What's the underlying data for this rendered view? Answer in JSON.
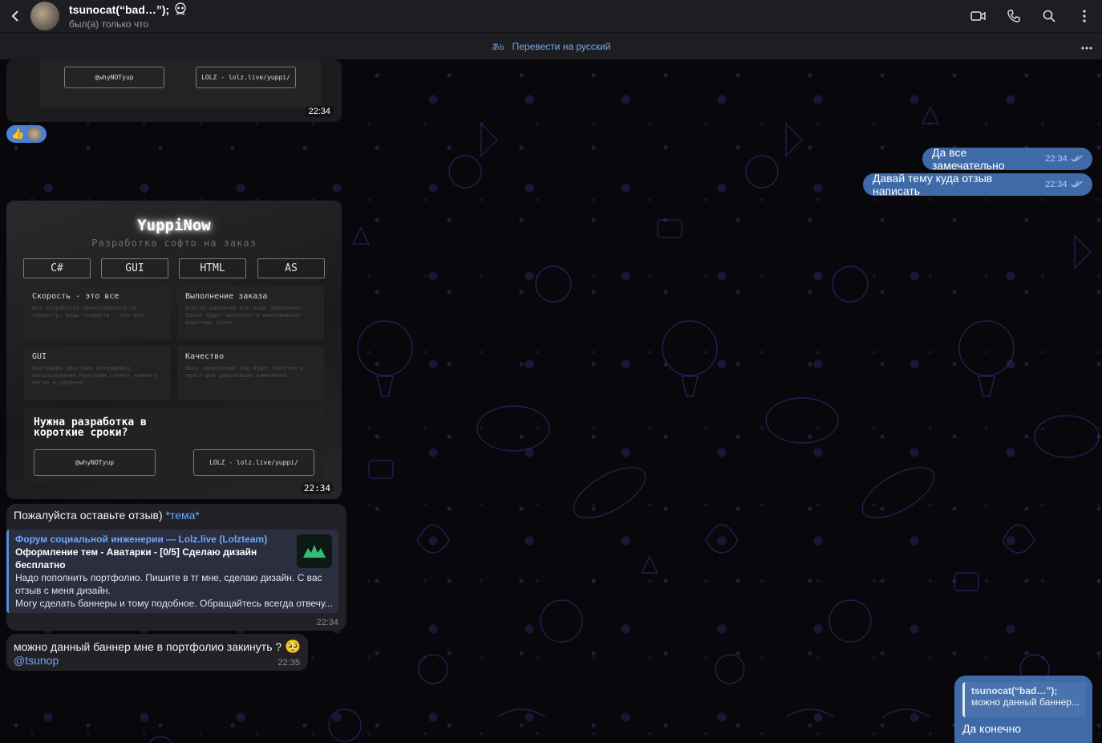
{
  "header": {
    "title": "tsunocat(“bad…”);",
    "status": "был(а) только что"
  },
  "translate_bar": {
    "label": "Перевести на русский"
  },
  "top_banner": {
    "btn_left": "@whyNOTyup",
    "btn_right": "LOLZ - lolz.live/yuppi/",
    "time": "22:34"
  },
  "banner": {
    "logo": "YuppiNow",
    "subtitle": "Разработка софто на заказ",
    "tags": [
      "C#",
      "GUI",
      "HTML",
      "AS"
    ],
    "cards": [
      {
        "title": "Скорость - это все",
        "text": "Вся разработка ориентирована на скорость, ведь скорость - это всё"
      },
      {
        "title": "Выполнение заказа",
        "text": "Всегда выполняю все ваши пожелания. Заказ будет выполнен в максимально короткие сроки"
      },
      {
        "title": "GUI",
        "text": "Благодаря простому интерфейсу, использование программ станет намного легче и удобнее"
      },
      {
        "title": "Качество",
        "text": "Весь написанный код будет понятен и прост для дальнейших изменений"
      }
    ],
    "cta": "Нужна разработка в короткие сроки?",
    "btn_left": "@whyNOTyup",
    "btn_right": "LOLZ - lolz.live/yuppi/",
    "time": "22:34"
  },
  "messages_out": [
    {
      "text": "Да все замечательно",
      "time": "22:34"
    },
    {
      "text": "Давай тему куда отзыв написать",
      "time": "22:34"
    }
  ],
  "review_msg": {
    "text": "Пожалуйста оставьте отзыв)",
    "link": "*тема*",
    "preview_site": "Форум социальной инженерии — Lolz.live (Lolzteam)",
    "preview_title": "Оформление тем - Аватарки - [0/5] Сделаю дизайн бесплатно",
    "preview_desc": "Надо пополнить портфолио. Пишите в тг мне, сделаю дизайн. С вас отзыв с меня дизайн.",
    "preview_desc2": "Могу сделать баннеры и тому подобное. Обращайтесь всегда отвечу...",
    "time": "22:34"
  },
  "question_msg": {
    "text": "можно данный баннер мне в портфолио закинуть ?",
    "mention": "@tsunop",
    "time": "22:35"
  },
  "reply_msg": {
    "quote_author": "tsunocat(“bad…”);",
    "quote_text": "можно данный баннер...",
    "text": "Да конечно"
  },
  "colors": {
    "accent": "#3e6aa8",
    "link": "#6ea6ff",
    "incoming": "#222226",
    "reaction": "#4a80d6"
  }
}
